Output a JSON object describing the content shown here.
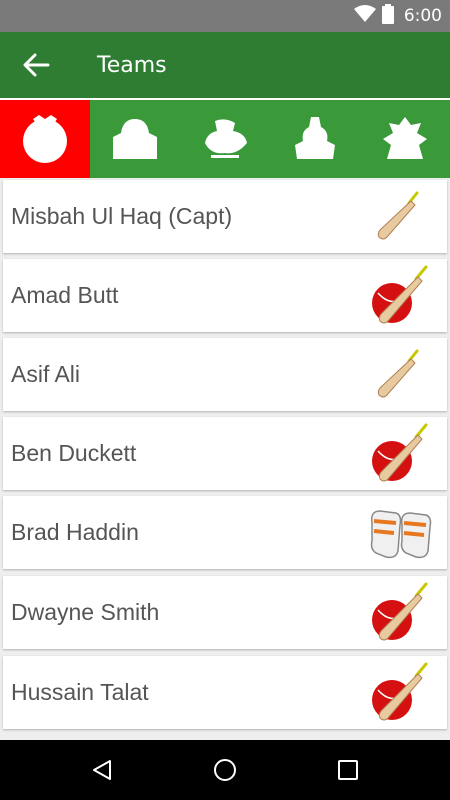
{
  "status_bar": {
    "time": "6:00"
  },
  "app_bar": {
    "title": "Teams"
  },
  "team_tabs": [
    {
      "icon": "team-logo-icon-1",
      "selected": true
    },
    {
      "icon": "team-logo-icon-2",
      "selected": false
    },
    {
      "icon": "team-logo-icon-3",
      "selected": false
    },
    {
      "icon": "team-logo-icon-4",
      "selected": false
    },
    {
      "icon": "team-logo-icon-5",
      "selected": false
    }
  ],
  "players": [
    {
      "name": "Misbah Ul Haq (Capt)",
      "role_icon": "bat-icon"
    },
    {
      "name": "Amad Butt",
      "role_icon": "bat-and-ball-icon"
    },
    {
      "name": "Asif Ali",
      "role_icon": "bat-icon"
    },
    {
      "name": "Ben Duckett",
      "role_icon": "bat-and-ball-icon"
    },
    {
      "name": "Brad Haddin",
      "role_icon": "wicket-keeping-gloves-icon"
    },
    {
      "name": "Dwayne Smith",
      "role_icon": "bat-and-ball-icon"
    },
    {
      "name": "Hussain Talat",
      "role_icon": "bat-and-ball-icon"
    }
  ],
  "colors": {
    "app_bar": "#2e7d32",
    "tabs_bg": "#3a9a3a",
    "selected_tab": "#ff0000",
    "status_bar": "#7a7a7a"
  }
}
